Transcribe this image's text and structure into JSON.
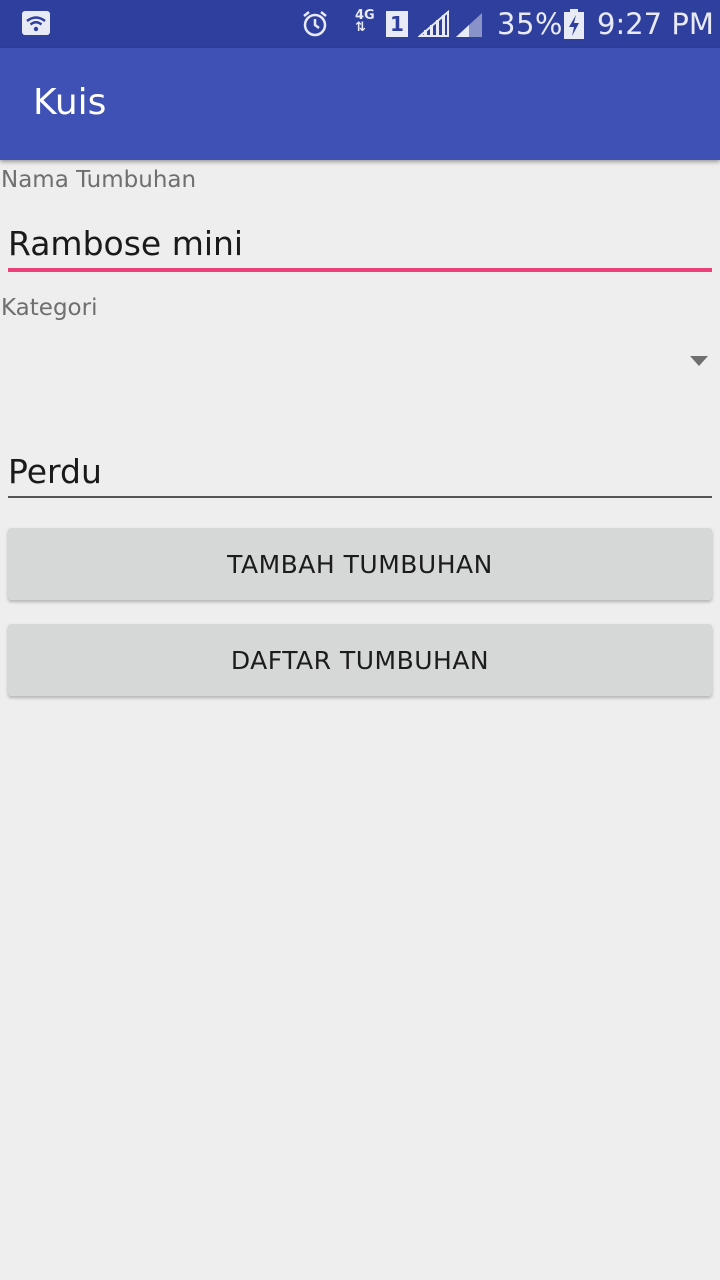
{
  "status_bar": {
    "battery_percent": "35%",
    "time": "9:27 PM",
    "network": "4G",
    "sim_slot": "1",
    "icons": [
      "wifi-icon",
      "alarm-icon",
      "network-4g-icon",
      "sim-1-icon",
      "signal-icon",
      "signal-icon-2",
      "battery-charging-icon"
    ]
  },
  "app_bar": {
    "title": "Kuis"
  },
  "form": {
    "nama_label": "Nama Tumbuhan",
    "nama_value": "Rambose mini",
    "kategori_label": "Kategori",
    "kategori_value": "Perdu"
  },
  "buttons": {
    "tambah": "TAMBAH TUMBUHAN",
    "daftar": "DAFTAR TUMBUHAN"
  },
  "colors": {
    "status_bar": "#2f3f9e",
    "app_bar": "#3f51b5",
    "accent": "#ec407a",
    "background": "#eeeeee",
    "button": "#d6d7d7"
  }
}
